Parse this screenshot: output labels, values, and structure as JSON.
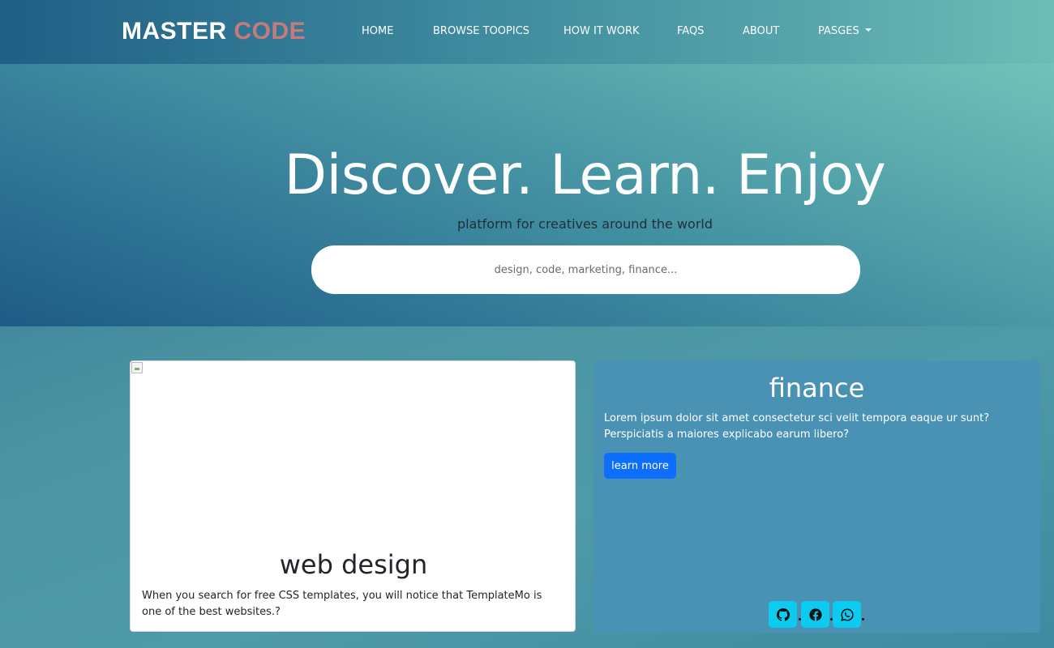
{
  "brand": {
    "text": "MASTER",
    "accent": "CODE"
  },
  "nav": {
    "items": [
      {
        "label": "HOME"
      },
      {
        "label": "BROWSE TOOPICS"
      },
      {
        "label": "HOW IT WORK"
      },
      {
        "label": "FAQS"
      },
      {
        "label": "ABOUT"
      },
      {
        "label": "PASGES"
      }
    ]
  },
  "hero": {
    "title": "Discover. Learn. Enjoy",
    "subtitle": "platform for creatives around the world",
    "search_placeholder": "design, code, marketing, finance..."
  },
  "cards": {
    "left": {
      "title": "web design",
      "text": "When you search for free CSS templates, you will notice that TemplateMo is one of the best websites.?"
    },
    "right": {
      "title": "finance",
      "text": "Lorem ipsum dolor sit amet consectetur sci velit tempora eaque ur sunt? Perspiciatis a maiores explicabo earum libero?",
      "button": "learn more",
      "social": [
        "github-icon",
        "facebook-icon",
        "whatsapp-icon"
      ]
    }
  },
  "colors": {
    "brand_accent": "#c77a7e",
    "primary_button": "#0d6efd",
    "social_button": "#0dcaf0",
    "finance_card": "#4a92b4"
  }
}
